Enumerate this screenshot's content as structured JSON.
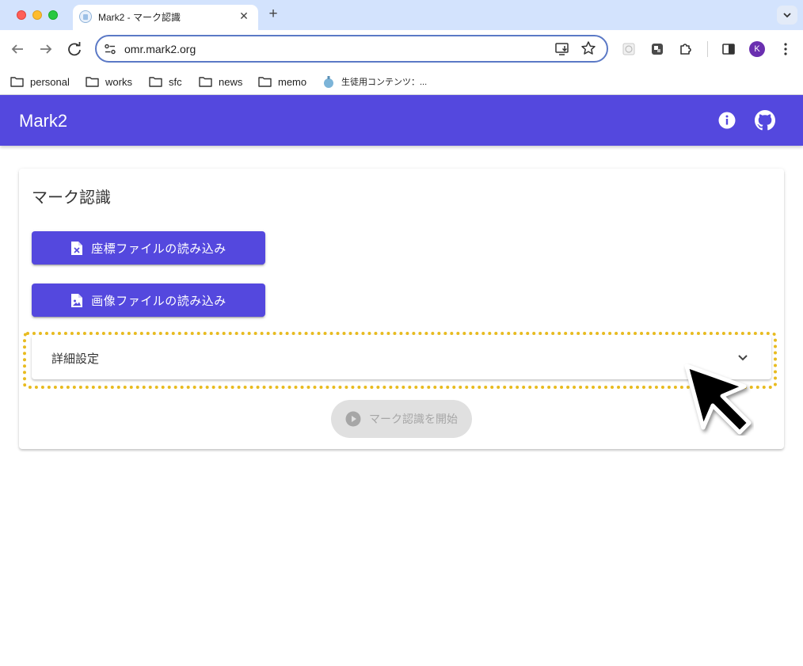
{
  "browser": {
    "tab_title": "Mark2 - マーク認識",
    "tab_close": "✕",
    "new_tab": "+",
    "url": "omr.mark2.org",
    "profile_initial": "K",
    "bookmarks": [
      {
        "label": "personal",
        "icon": "folder-icon"
      },
      {
        "label": "works",
        "icon": "folder-icon"
      },
      {
        "label": "sfc",
        "icon": "folder-icon"
      },
      {
        "label": "news",
        "icon": "folder-icon"
      },
      {
        "label": "memo",
        "icon": "folder-icon"
      },
      {
        "label": "生徒用コンテンツ：...",
        "icon": "site-icon"
      }
    ]
  },
  "app": {
    "title": "Mark2",
    "brand_color": "#5448de",
    "icons": [
      "info-icon",
      "github-icon"
    ]
  },
  "card": {
    "title": "マーク認識",
    "coord_button": "座標ファイルの読み込み",
    "image_button": "画像ファイルの読み込み",
    "advanced_label": "詳細設定",
    "start_button": "マーク認識を開始"
  },
  "highlight_color": "#e8bb1f"
}
